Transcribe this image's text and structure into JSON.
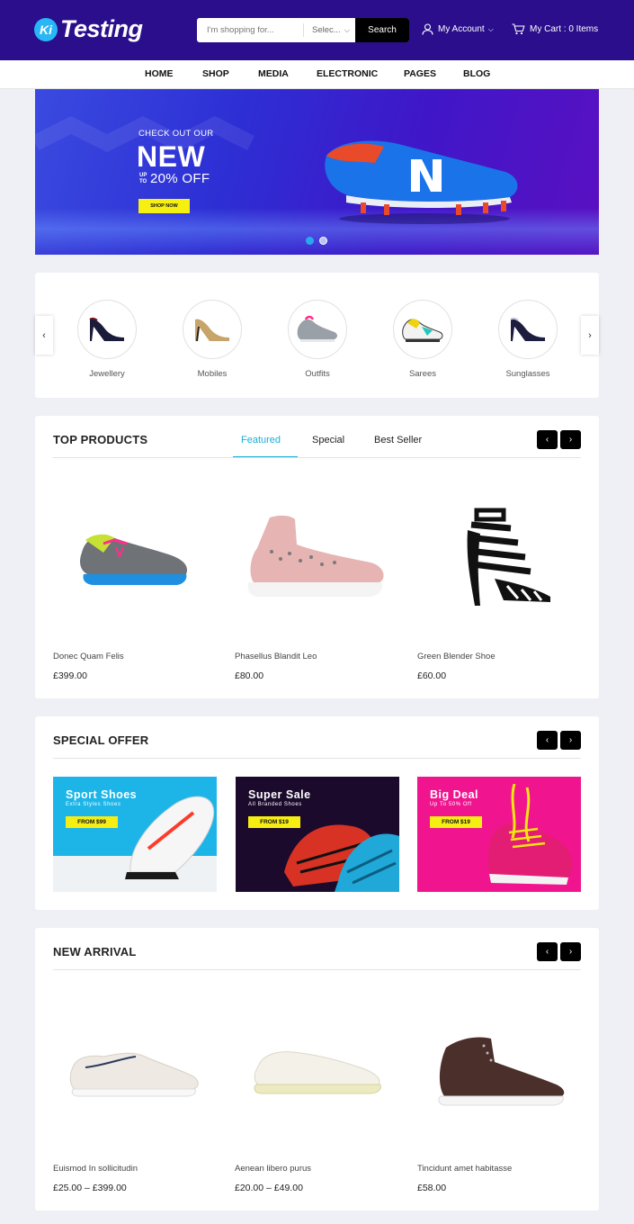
{
  "header": {
    "logo_badge": "Ki",
    "logo_text": "Testing",
    "search_placeholder": "I'm shopping for...",
    "search_category": "Selec...",
    "search_button": "Search",
    "account_label": "My Account",
    "cart_label": "My Cart : 0 Items"
  },
  "nav": {
    "items": [
      "HOME",
      "SHOP",
      "MEDIA",
      "ELECTRONIC",
      "PAGES",
      "BLOG"
    ]
  },
  "hero": {
    "eyebrow": "CHECK OUT OUR",
    "headline": "NEW",
    "upto": "UP TO",
    "offer": "20% OFF",
    "button": "SHOP NOW",
    "active_slide": 1,
    "slide_count": 2
  },
  "categories": {
    "items": [
      {
        "label": "Jewellery",
        "icon": "high-heel-icon"
      },
      {
        "label": "Mobiles",
        "icon": "high-heel-icon"
      },
      {
        "label": "Outfits",
        "icon": "sneaker-icon"
      },
      {
        "label": "Sarees",
        "icon": "sneaker-icon"
      },
      {
        "label": "Sunglasses",
        "icon": "high-heel-icon"
      }
    ]
  },
  "top_products": {
    "title": "TOP PRODUCTS",
    "tabs": [
      "Featured",
      "Special",
      "Best Seller"
    ],
    "active_tab": "Featured",
    "items": [
      {
        "name": "Donec Quam Felis",
        "price": "£399.00"
      },
      {
        "name": "Phasellus Blandit Leo",
        "price": "£80.00"
      },
      {
        "name": "Green Blender Shoe",
        "price": "£60.00"
      }
    ]
  },
  "special_offer": {
    "title": "SPECIAL OFFER",
    "banners": [
      {
        "title": "Sport Shoes",
        "subtitle": "Extra Styles Shoes",
        "tag": "FROM $99",
        "bg": "#1db5e8"
      },
      {
        "title": "Super Sale",
        "subtitle": "All Branded Shoes",
        "tag": "FROM $19",
        "bg": "#1c0a2c"
      },
      {
        "title": "Big Deal",
        "subtitle": "Up To 50% Off",
        "tag": "FROM $19",
        "bg": "#f0158f"
      }
    ]
  },
  "new_arrival": {
    "title": "NEW ARRIVAL",
    "items": [
      {
        "name": "Euismod In sollicitudin",
        "price": "£25.00 – £399.00"
      },
      {
        "name": "Aenean libero purus",
        "price": "£20.00 – £49.00"
      },
      {
        "name": "Tincidunt amet habitasse",
        "price": "£58.00"
      }
    ]
  },
  "colors": {
    "header_bg": "#2a0e8c",
    "accent": "#14b0d8",
    "yellow_tag": "#f5ef12"
  }
}
